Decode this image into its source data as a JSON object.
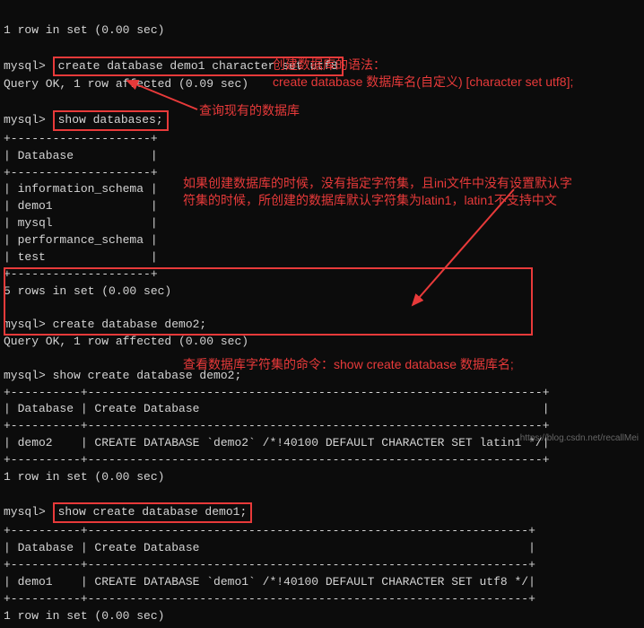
{
  "prompt": "mysql> ",
  "cmds": {
    "create_utf8": "create database demo1 character set utf8",
    "show_dbs": "show databases;",
    "create_demo2": "create database demo2;",
    "show_create_demo2": "show create database demo2;",
    "show_create_demo1": "show create database demo1;"
  },
  "responses": {
    "utf8_ok": "Query OK, 1 row affected (0.09 sec)",
    "demo2_ok": "Query OK, 1 row affected (0.00 sec)",
    "rows5": "5 rows in set (0.00 sec)",
    "row1a": "1 row in set (0.00 sec)",
    "row1b": "1 row in set (0.00 sec)"
  },
  "db_list": {
    "sep_top": "+--------------------+",
    "header": "| Database           |",
    "sep_mid": "+--------------------+",
    "r1": "| information_schema |",
    "r2": "| demo1              |",
    "r3": "| mysql              |",
    "r4": "| performance_schema |",
    "r5": "| test               |",
    "sep_bot": "+--------------------+"
  },
  "tbl_demo2": {
    "sep": "+----------+-----------------------------------------------------------------+",
    "header": "| Database | Create Database                                                 |",
    "row": "| demo2    | CREATE DATABASE `demo2` /*!40100 DEFAULT CHARACTER SET latin1 */|"
  },
  "tbl_demo1": {
    "sep": "+----------+---------------------------------------------------------------+",
    "header": "| Database | Create Database                                               |",
    "row": "| demo1    | CREATE DATABASE `demo1` /*!40100 DEFAULT CHARACTER SET utf8 */|"
  },
  "anno": {
    "a1_l1": "创建数据库的语法：",
    "a1_l2": "create database 数据库名(自定义) [character set utf8];",
    "a2": "查询现有的数据库",
    "a3_l1": "如果创建数据库的时候，没有指定字符集，且ini文件中没有设置默认字",
    "a3_l2": "符集的时候，所创建的数据库默认字符集为latin1，latin1不支持中文",
    "a4": "查看数据库字符集的命令：show create database 数据库名;"
  },
  "watermark": "https://blog.csdn.net/recallMei"
}
